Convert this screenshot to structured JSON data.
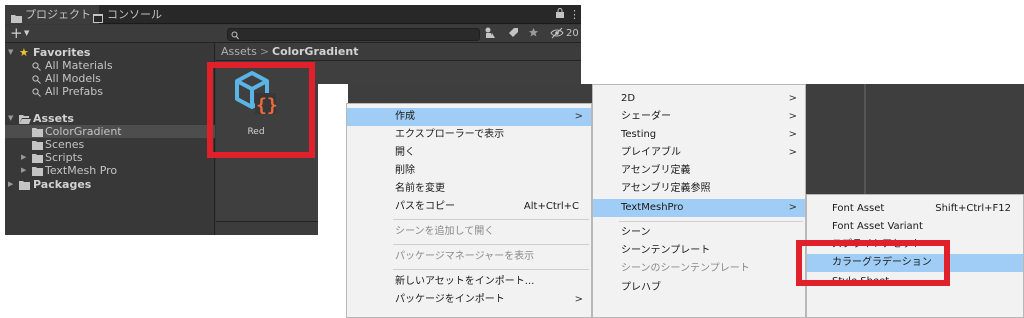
{
  "tabs": {
    "project": "プロジェクト",
    "console": "コンソール"
  },
  "toolbar": {
    "search_placeholder": "",
    "hidden_count": "20"
  },
  "favorites": {
    "label": "Favorites",
    "items": [
      "All Materials",
      "All Models",
      "All Prefabs"
    ]
  },
  "assets_tree": {
    "label": "Assets",
    "children": [
      "ColorGradient",
      "Scenes",
      "Scripts",
      "TextMesh Pro"
    ],
    "packages": "Packages"
  },
  "breadcrumb": {
    "root": "Assets",
    "sep": ">",
    "current": "ColorGradient"
  },
  "asset": {
    "name": "Red"
  },
  "context_menu": [
    {
      "label": "作成",
      "arrow": ">"
    },
    {
      "label": "エクスプローラーで表示"
    },
    {
      "label": "開く"
    },
    {
      "label": "削除"
    },
    {
      "label": "名前を変更"
    },
    {
      "label": "パスをコピー",
      "shortcut": "Alt+Ctrl+C"
    },
    {
      "label": "シーンを追加して開く"
    },
    {
      "label": "パッケージマネージャーを表示"
    },
    {
      "label": "新しいアセットをインポート..."
    },
    {
      "label": "パッケージをインポート",
      "arrow": ">"
    }
  ],
  "create_submenu": [
    {
      "label": "2D",
      "arrow": ">"
    },
    {
      "label": "シェーダー",
      "arrow": ">"
    },
    {
      "label": "Testing",
      "arrow": ">"
    },
    {
      "label": "プレイアブル",
      "arrow": ">"
    },
    {
      "label": "アセンブリ定義"
    },
    {
      "label": "アセンブリ定義参照"
    },
    {
      "label": "TextMeshPro",
      "arrow": ">"
    },
    {
      "label": "シーン"
    },
    {
      "label": "シーンテンプレート"
    },
    {
      "label": "シーンのシーンテンプレート"
    },
    {
      "label": "プレハブ"
    }
  ],
  "textmeshpro_submenu": [
    {
      "label": "Font Asset",
      "shortcut": "Shift+Ctrl+F12"
    },
    {
      "label": "Font Asset Variant"
    },
    {
      "label": "スプライトアセット"
    },
    {
      "label": "カラーグラデーション"
    },
    {
      "label": "Style Sheet"
    }
  ],
  "colors": {
    "highlight": "#9fcdf5",
    "annotation_red": "#e0202a",
    "editor_bg": "#383838"
  }
}
